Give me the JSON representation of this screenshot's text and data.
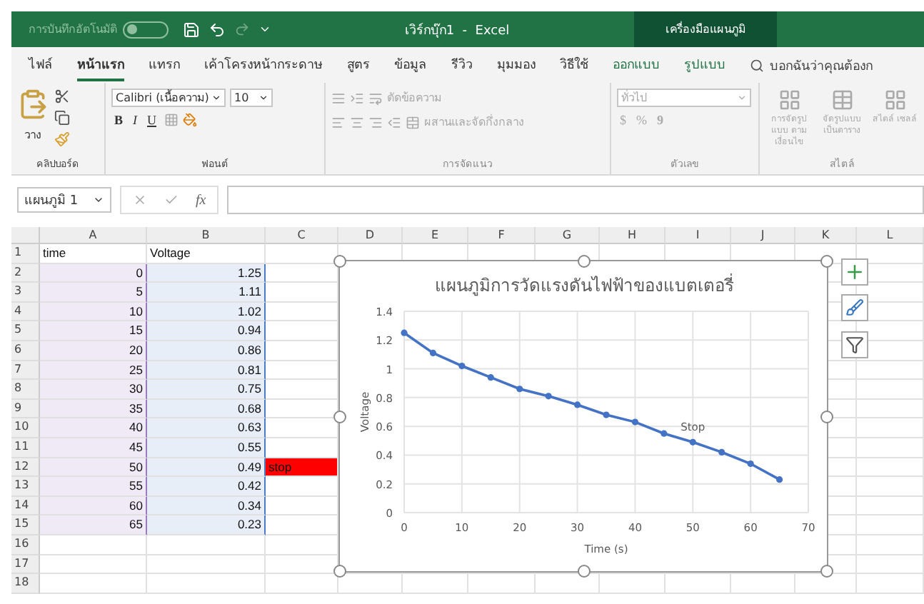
{
  "title_bar": {
    "autosave_label": "การบันทึกอัตโนมัติ",
    "autosave_on": false,
    "title": "เวิร์กบุ๊ก1  -  Excel",
    "context_tab": "เครื่องมือแผนภูมิ"
  },
  "ribbon_tabs": [
    {
      "label": "ไฟล์",
      "selected": false,
      "contextual": false
    },
    {
      "label": "หน้าแรก",
      "selected": true,
      "contextual": false
    },
    {
      "label": "แทรก",
      "selected": false,
      "contextual": false
    },
    {
      "label": "เค้าโครงหน้ากระดาษ",
      "selected": false,
      "contextual": false
    },
    {
      "label": "สูตร",
      "selected": false,
      "contextual": false
    },
    {
      "label": "ข้อมูล",
      "selected": false,
      "contextual": false
    },
    {
      "label": "รีวิว",
      "selected": false,
      "contextual": false
    },
    {
      "label": "มุมมอง",
      "selected": false,
      "contextual": false
    },
    {
      "label": "วิธีใช้",
      "selected": false,
      "contextual": false
    },
    {
      "label": "ออกแบบ",
      "selected": false,
      "contextual": true
    },
    {
      "label": "รูปแบบ",
      "selected": false,
      "contextual": true
    }
  ],
  "tell_me": "บอกฉันว่าคุณต้องก",
  "clipboard": {
    "paste": "วาง",
    "label": "คลิปบอร์ด"
  },
  "font": {
    "name": "Calibri (เนื้อความ)",
    "size": "10",
    "bold": "B",
    "italic": "I",
    "underline": "U",
    "label": "ฟอนต์"
  },
  "alignment": {
    "wrap": "ตัดข้อความ",
    "merge": "ผสานและจัดกึ่งกลาง",
    "label": "การจัดแนว",
    "disabled": true
  },
  "number": {
    "format": "ทั่วไป",
    "currency": "$",
    "percent": "%",
    "comma": "9",
    "label": "ตัวเลข",
    "disabled": true
  },
  "styles": {
    "items": [
      "การจัดรูปแบบ ตามเงื่อนไข",
      "จัดรูปแบบ เป็นตาราง",
      "สไตล์ เซลล์"
    ],
    "label": "สไตล์",
    "disabled": true
  },
  "name_box": "แผนภูมิ 1",
  "formula_fx": "fx",
  "columns": [
    "A",
    "B",
    "C",
    "D",
    "E",
    "F",
    "G",
    "H",
    "I",
    "J",
    "K",
    "L"
  ],
  "rows": [
    {
      "number": "1",
      "a": "time",
      "b": "Voltage",
      "in_range": false
    },
    {
      "number": "2",
      "a": "0",
      "b": "1.25",
      "in_range": true
    },
    {
      "number": "3",
      "a": "5",
      "b": "1.11",
      "in_range": true
    },
    {
      "number": "4",
      "a": "10",
      "b": "1.02",
      "in_range": true
    },
    {
      "number": "5",
      "a": "15",
      "b": "0.94",
      "in_range": true
    },
    {
      "number": "6",
      "a": "20",
      "b": "0.86",
      "in_range": true
    },
    {
      "number": "7",
      "a": "25",
      "b": "0.81",
      "in_range": true
    },
    {
      "number": "8",
      "a": "30",
      "b": "0.75",
      "in_range": true
    },
    {
      "number": "9",
      "a": "35",
      "b": "0.68",
      "in_range": true
    },
    {
      "number": "10",
      "a": "40",
      "b": "0.63",
      "in_range": true
    },
    {
      "number": "11",
      "a": "45",
      "b": "0.55",
      "in_range": true
    },
    {
      "number": "12",
      "a": "50",
      "b": "0.49",
      "c": "stop",
      "c_highlighted": true,
      "in_range": true
    },
    {
      "number": "13",
      "a": "55",
      "b": "0.42",
      "in_range": true
    },
    {
      "number": "14",
      "a": "60",
      "b": "0.34",
      "in_range": true
    },
    {
      "number": "15",
      "a": "65",
      "b": "0.23",
      "in_range": true
    },
    {
      "number": "16",
      "in_range": false
    },
    {
      "number": "17",
      "in_range": false
    },
    {
      "number": "18",
      "in_range": false
    }
  ],
  "chart": {
    "chart_data": {
      "type": "line",
      "title": "แผนภูมิการวัดแรงดันไฟฟ้าของแบตเตอรี่",
      "xlabel": "Time (s)",
      "ylabel": "Voltage",
      "x": [
        0,
        5,
        10,
        15,
        20,
        25,
        30,
        35,
        40,
        45,
        50,
        55,
        60,
        65
      ],
      "series": [
        {
          "color": "#4472c4",
          "marker": true,
          "values": [
            1.25,
            1.11,
            1.02,
            0.94,
            0.86,
            0.81,
            0.75,
            0.68,
            0.63,
            0.55,
            0.49,
            0.42,
            0.34,
            0.23
          ]
        }
      ],
      "xlim": [
        0,
        70
      ],
      "ylim": [
        0,
        1.4
      ],
      "grid": true,
      "xticks": [
        0,
        10,
        20,
        30,
        40,
        50,
        60,
        70
      ],
      "yticks": [
        0,
        0.2,
        0.4,
        0.6,
        0.8,
        {
          "value": 1,
          "label": "1"
        },
        1.2,
        1.4
      ],
      "annotations": [
        "Stop"
      ]
    }
  }
}
